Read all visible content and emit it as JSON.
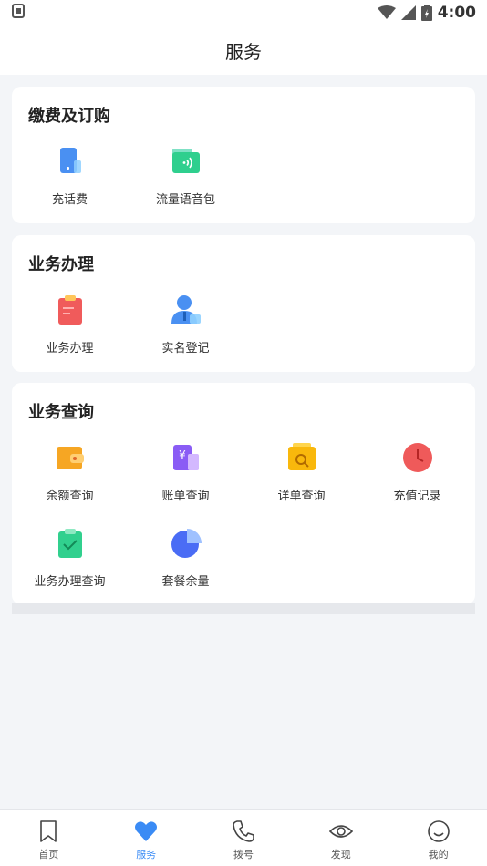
{
  "status_bar": {
    "left_icon_text": "SIM",
    "time": "4:00"
  },
  "header": {
    "title": "服务"
  },
  "sections": [
    {
      "title": "缴费及订购",
      "items": [
        {
          "label": "充话费",
          "icon": "phone-recharge-icon"
        },
        {
          "label": "流量语音包",
          "icon": "data-voice-pack-icon"
        }
      ]
    },
    {
      "title": "业务办理",
      "items": [
        {
          "label": "业务办理",
          "icon": "clipboard-icon"
        },
        {
          "label": "实名登记",
          "icon": "user-id-icon"
        }
      ]
    },
    {
      "title": "业务查询",
      "items": [
        {
          "label": "余额查询",
          "icon": "wallet-icon"
        },
        {
          "label": "账单查询",
          "icon": "bill-icon"
        },
        {
          "label": "详单查询",
          "icon": "detail-search-icon"
        },
        {
          "label": "充值记录",
          "icon": "clock-icon"
        },
        {
          "label": "业务办理查询",
          "icon": "clipboard-check-icon"
        },
        {
          "label": "套餐余量",
          "icon": "pie-chart-icon"
        }
      ]
    }
  ],
  "tabbar": {
    "tabs": [
      {
        "label": "首页",
        "icon": "bookmark-icon",
        "active": false
      },
      {
        "label": "服务",
        "icon": "heart-icon",
        "active": true
      },
      {
        "label": "拨号",
        "icon": "phone-icon",
        "active": false
      },
      {
        "label": "发现",
        "icon": "eye-icon",
        "active": false
      },
      {
        "label": "我的",
        "icon": "smile-icon",
        "active": false
      }
    ]
  },
  "colors": {
    "accent": "#3a8bf5",
    "background": "#f3f5f8"
  }
}
